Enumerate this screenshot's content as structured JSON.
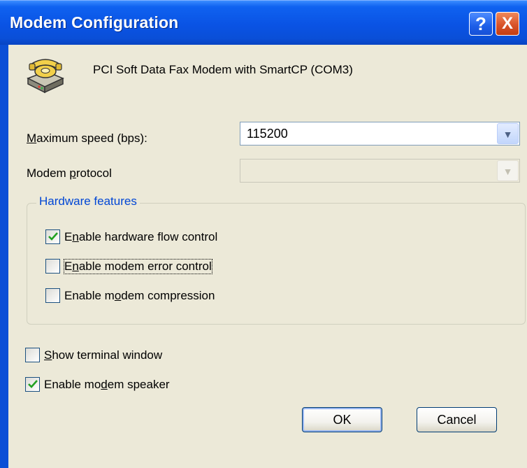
{
  "window": {
    "title": "Modem Configuration"
  },
  "title_buttons": {
    "help": "?",
    "close": "X"
  },
  "modem": {
    "name": "PCI Soft Data Fax Modem with SmartCP (COM3)",
    "icon": "telephone-modem-icon"
  },
  "max_speed": {
    "label_u": "M",
    "label_rest": "aximum speed (bps):",
    "value": "115200"
  },
  "protocol": {
    "label_pre": "Modem ",
    "label_u": "p",
    "label_rest": "rotocol",
    "value": ""
  },
  "hardware": {
    "legend": "Hardware features",
    "flow": {
      "pre": "E",
      "u": "n",
      "post": "able hardware flow control",
      "checked": true
    },
    "error": {
      "pre": "E",
      "u": "n",
      "post": "able modem error control",
      "checked": false
    },
    "compression": {
      "pre": "Enable m",
      "u": "o",
      "post": "dem compression",
      "checked": false
    }
  },
  "terminal": {
    "pre": "",
    "u": "S",
    "post": "how terminal window",
    "checked": false
  },
  "speaker": {
    "pre": "Enable mo",
    "u": "d",
    "post": "em speaker",
    "checked": true
  },
  "buttons": {
    "ok": "OK",
    "cancel": "Cancel"
  }
}
